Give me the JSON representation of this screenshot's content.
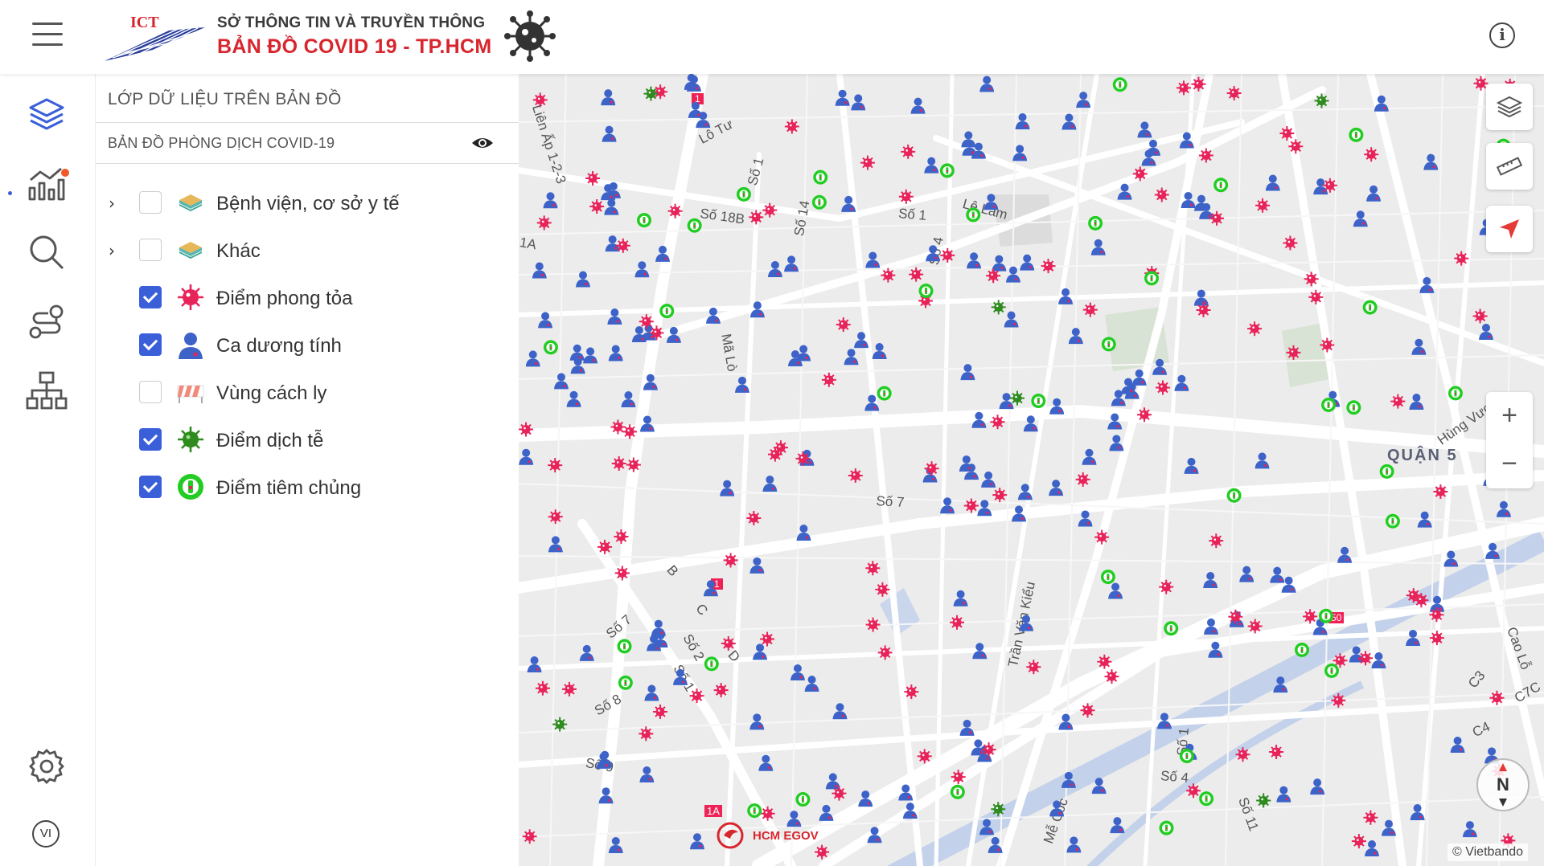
{
  "header": {
    "logo_text": "ICT",
    "org_title": "SỞ THÔNG TIN VÀ TRUYỀN THÔNG",
    "app_title": "BẢN ĐỒ  COVID 19 - TP.HCM"
  },
  "rail": {
    "items": [
      "layers",
      "statistics",
      "search",
      "route",
      "hierarchy"
    ],
    "settings": "settings",
    "language": "VI"
  },
  "panel": {
    "title": "LỚP DỮ LIỆU TRÊN BẢN ĐỒ",
    "group_title": "BẢN ĐỒ PHÒNG DỊCH COVID-19",
    "layers": [
      {
        "label": "Bệnh viện, cơ sở y tế",
        "checked": false,
        "expandable": true,
        "icon": "layer-stack-icon"
      },
      {
        "label": "Khác",
        "checked": false,
        "expandable": true,
        "icon": "layer-stack-icon"
      },
      {
        "label": "Điểm phong tỏa",
        "checked": true,
        "expandable": false,
        "icon": "red-virus-icon"
      },
      {
        "label": "Ca dương tính",
        "checked": true,
        "expandable": false,
        "icon": "person-icon"
      },
      {
        "label": "Vùng cách ly",
        "checked": false,
        "expandable": false,
        "icon": "barrier-icon"
      },
      {
        "label": "Điểm dịch tễ",
        "checked": true,
        "expandable": false,
        "icon": "green-virus-icon"
      },
      {
        "label": "Điểm tiêm chủng",
        "checked": true,
        "expandable": false,
        "icon": "vaccine-icon"
      }
    ]
  },
  "map": {
    "district_label": "QUẬN 5",
    "road_labels": [
      "Liên Ấp 1-2-3",
      "Lô Tư",
      "Số 1",
      "Số 18B",
      "Số 14",
      "Số 1",
      "Lê Lâm",
      "Số 4",
      "1A",
      "Mã Lò",
      "Số 7",
      "B",
      "C",
      "D",
      "Số 7",
      "Số 2",
      "Số 1",
      "Số 8",
      "Số 9",
      "Trần Văn Kiểu",
      "Mễ Cốc",
      "Số 1",
      "Số 4",
      "Số 11",
      "Hùng Vương",
      "Cao Lỗ",
      "C3",
      "C4",
      "C7C",
      "1A"
    ],
    "route_shields": [
      "1",
      "1",
      "1A",
      "50"
    ],
    "attribution": "© Vietbando",
    "egov_label": "HCM EGOV",
    "compass_label": "N",
    "zoom_in": "+",
    "zoom_out": "−"
  },
  "colors": {
    "accent": "#3b5fd9",
    "brand_red": "#d7262e",
    "lockdown_marker": "#e8235a",
    "case_marker": "#3d63c9",
    "vaccine_marker": "#22cc22",
    "epidemic_marker": "#2e8b1e"
  }
}
